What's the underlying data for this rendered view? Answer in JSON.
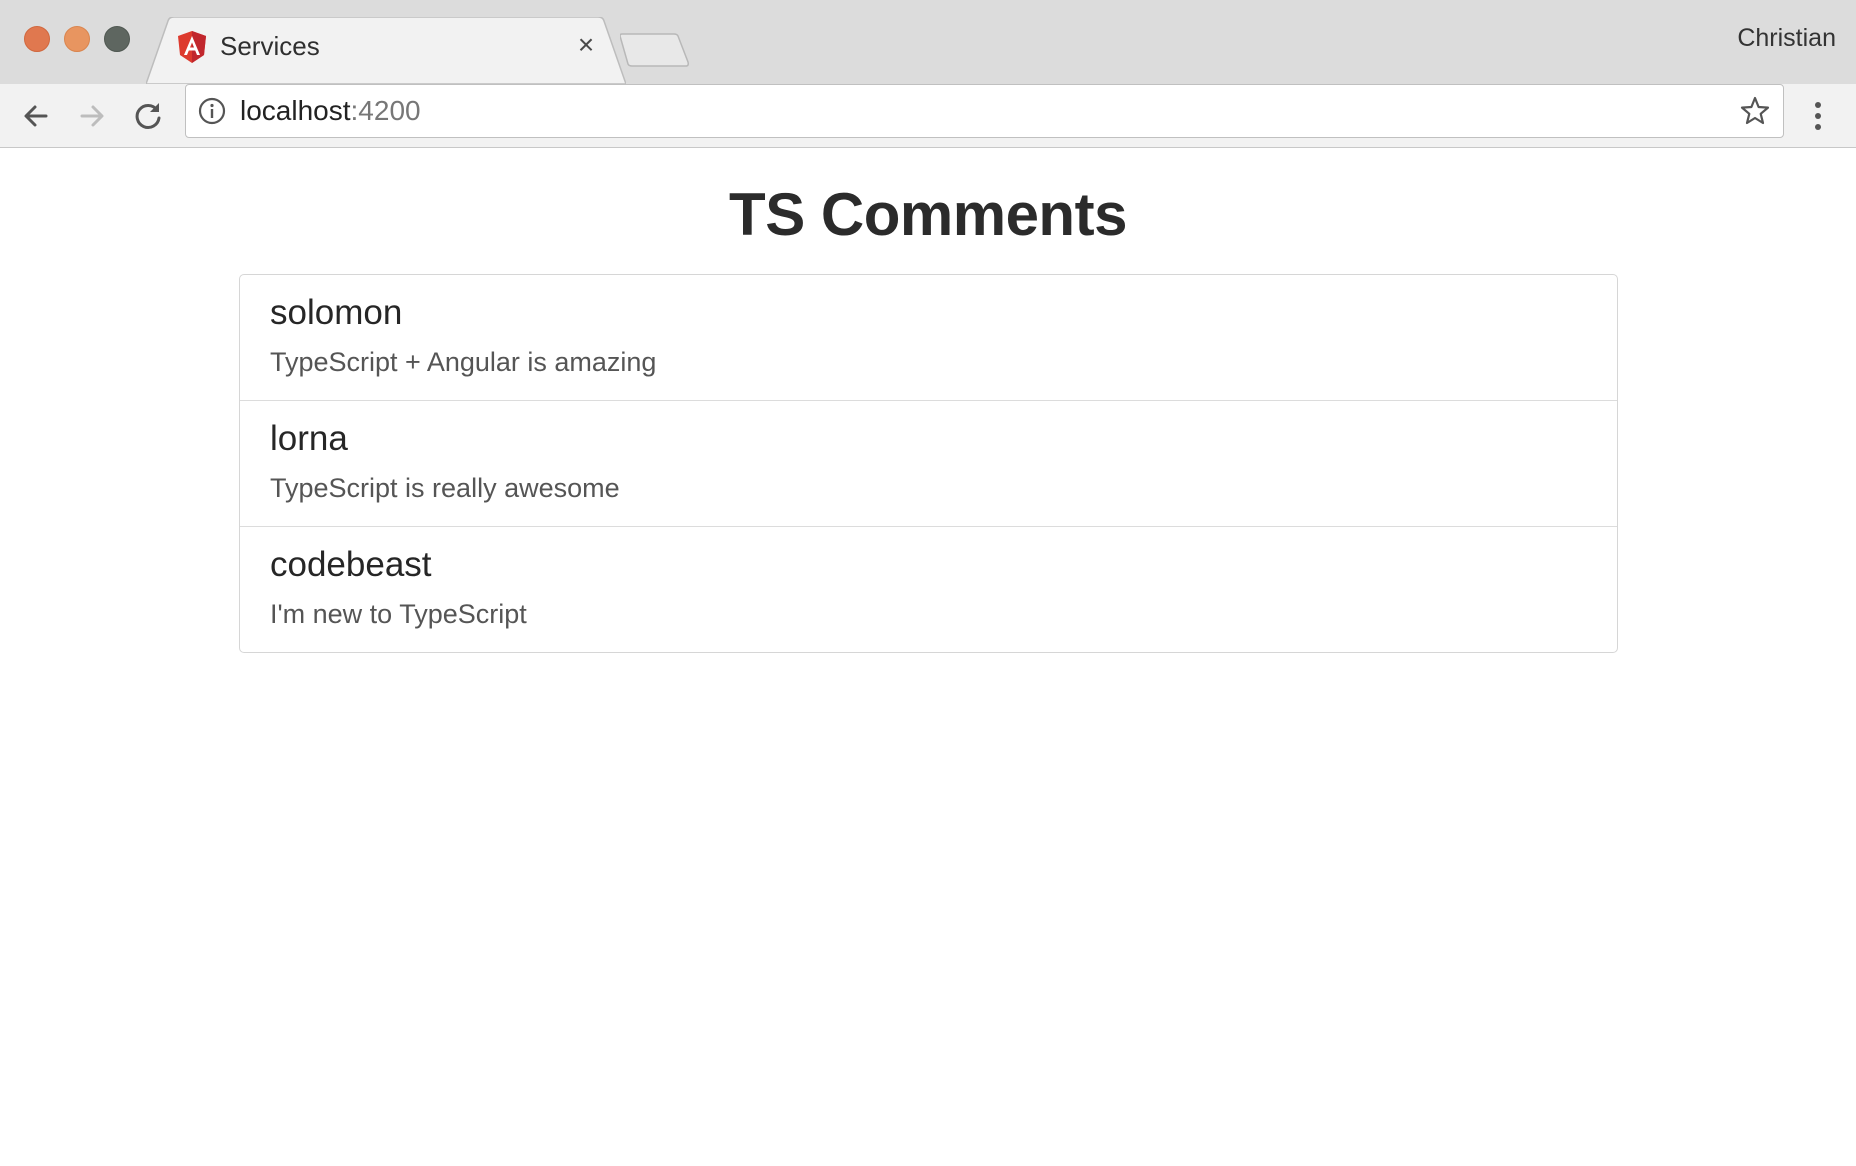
{
  "browser": {
    "tab": {
      "title": "Services",
      "favicon": "angular-icon",
      "close_icon": "close-icon"
    },
    "profile_name": "Christian",
    "address_bar": {
      "host": "localhost",
      "port": ":4200"
    },
    "icons": {
      "back": "back-arrow-icon",
      "forward": "forward-arrow-icon",
      "reload": "reload-icon",
      "info": "info-icon",
      "bookmark": "star-icon",
      "menu": "more-vertical-icon"
    },
    "colors": {
      "close": "#e0784f",
      "minimize": "#e89560",
      "maximize": "#5e6660",
      "angular_red": "#dd3a2e"
    }
  },
  "page": {
    "title": "TS Comments",
    "comments": [
      {
        "author": "solomon",
        "text": "TypeScript + Angular is amazing"
      },
      {
        "author": "lorna",
        "text": "TypeScript is really awesome"
      },
      {
        "author": "codebeast",
        "text": "I'm new to TypeScript"
      }
    ]
  }
}
